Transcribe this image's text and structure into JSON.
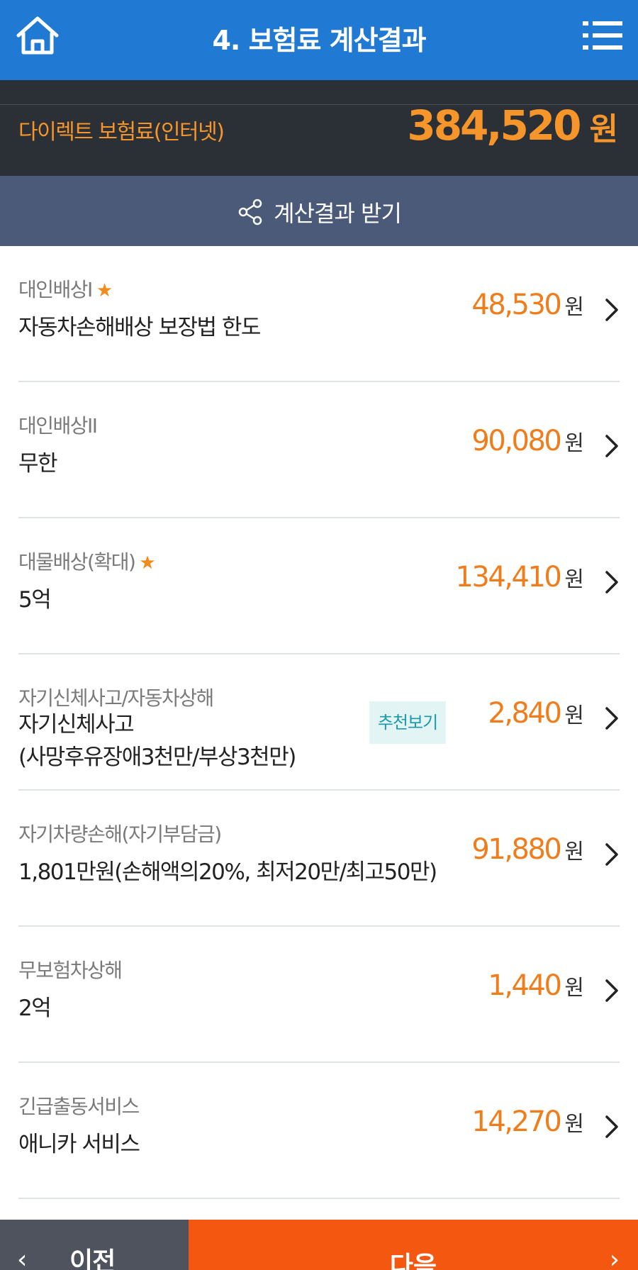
{
  "header": {
    "title": "4. 보험료 계산결과",
    "home_icon": "home-icon",
    "menu_icon": "menu-list-icon"
  },
  "premium": {
    "label": "다이렉트 보험료(인터넷)",
    "amount": "384,520",
    "unit": "원"
  },
  "share": {
    "label": "계산결과 받기",
    "icon": "share-icon"
  },
  "items": [
    {
      "category": "대인배상I",
      "starred": true,
      "description": "자동차손해배상 보장법 한도",
      "amount": "48,530",
      "unit": "원"
    },
    {
      "category": "대인배상II",
      "starred": false,
      "description": "무한",
      "amount": "90,080",
      "unit": "원"
    },
    {
      "category": "대물배상(확대)",
      "starred": true,
      "description": "5억",
      "amount": "134,410",
      "unit": "원"
    },
    {
      "category": "자기신체사고/자동차상해",
      "starred": false,
      "description": "자기신체사고\n(사망후유장애3천만/부상3천만)",
      "amount": "2,840",
      "unit": "원",
      "recommend_label": "추천보기"
    },
    {
      "category": "자기차량손해(자기부담금)",
      "starred": false,
      "description": "1,801만원(손해액의20%, 최저20만/최고50만)",
      "amount": "91,880",
      "unit": "원"
    },
    {
      "category": "무보험차상해",
      "starred": false,
      "description": "2억",
      "amount": "1,440",
      "unit": "원"
    },
    {
      "category": "긴급출동서비스",
      "starred": false,
      "description": "애니카 서비스",
      "amount": "14,270",
      "unit": "원"
    }
  ],
  "star_glyph": "★",
  "footer": {
    "prev_label": "이전",
    "next_label": "다음",
    "prev_arrow": "‹",
    "next_arrow": "›"
  },
  "colors": {
    "header_bg": "#2079d2",
    "premium_bg": "#2b2f36",
    "accent_orange": "#f5952a",
    "share_bg": "#4b5a78",
    "next_bg": "#f4570f",
    "prev_bg": "#4e535d"
  }
}
